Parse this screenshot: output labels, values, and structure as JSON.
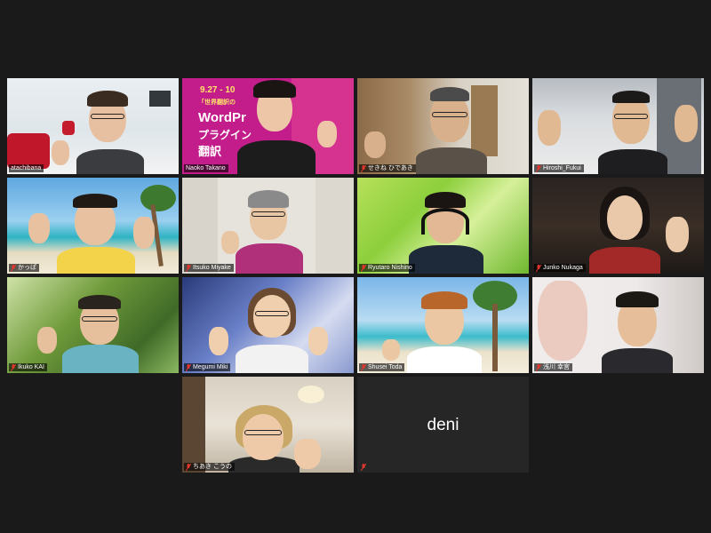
{
  "meeting": {
    "participants": [
      {
        "id": "p1",
        "name": "atachibana",
        "active": true,
        "muted": false
      },
      {
        "id": "p2",
        "name": "Naoko Takano",
        "active": false,
        "muted": false
      },
      {
        "id": "p3",
        "name": "せきね ひであき",
        "active": false,
        "muted": true
      },
      {
        "id": "p4",
        "name": "Hiroshi_Fukui",
        "active": false,
        "muted": true
      },
      {
        "id": "p5",
        "name": "かっぱ",
        "active": false,
        "muted": true
      },
      {
        "id": "p6",
        "name": "Itsuko Miyake",
        "active": false,
        "muted": true
      },
      {
        "id": "p7",
        "name": "Ryutaro Nishino",
        "active": false,
        "muted": true
      },
      {
        "id": "p8",
        "name": "Junko Nukaga",
        "active": false,
        "muted": true
      },
      {
        "id": "p9",
        "name": "Ikuko KAI",
        "active": false,
        "muted": true
      },
      {
        "id": "p10",
        "name": "Megumi Miki",
        "active": false,
        "muted": true
      },
      {
        "id": "p11",
        "name": "Shusei Toda",
        "active": false,
        "muted": true
      },
      {
        "id": "p12",
        "name": "浅川 幸宮",
        "active": false,
        "muted": true
      },
      {
        "id": "p13",
        "name": "ちあき こうの",
        "active": false,
        "muted": true
      },
      {
        "id": "p14",
        "name": "deni",
        "active": false,
        "muted": true,
        "video_off": true
      }
    ],
    "poster": {
      "date": "9.27 - 10",
      "line1": "「世界翻訳の",
      "line2": "WordPr",
      "line3": "プラグイン",
      "line4": "翻訳"
    },
    "colors": {
      "active_outline": "#f2e24a",
      "muted_icon": "#e0362c",
      "background": "#1a1a1a"
    }
  }
}
